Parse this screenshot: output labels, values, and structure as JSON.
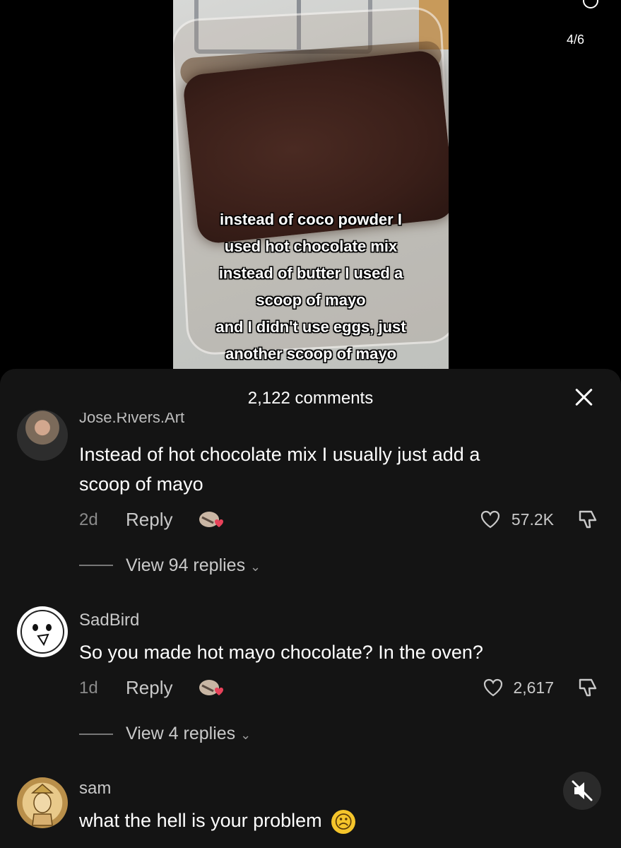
{
  "video": {
    "page_counter": "4/6",
    "caption_lines": [
      "instead of coco powder I",
      "used hot chocolate mix",
      "instead of butter I used a",
      "scoop of mayo",
      "and I didn't use eggs, just",
      "another scoop of mayo"
    ]
  },
  "sheet": {
    "title": "2,122 comments"
  },
  "comments": [
    {
      "username": "Jose.Rivers.Art",
      "text_line1": "Instead of hot chocolate mix I usually just add a",
      "text_line2": "scoop of mayo",
      "age": "2d",
      "reply_label": "Reply",
      "likes": "57.2K",
      "view_replies": "View 94 replies"
    },
    {
      "username": "SadBird",
      "text": "So you made hot mayo chocolate? In the oven?",
      "age": "1d",
      "reply_label": "Reply",
      "likes": "2,617",
      "view_replies": "View 4 replies"
    },
    {
      "username": "sam",
      "text": "what the hell is your problem",
      "emoji": "☹"
    }
  ],
  "icons": {
    "close": "close-icon",
    "heart": "heart-icon",
    "dislike": "thumbs-down-icon",
    "mute": "mute-icon",
    "chevron": "chevron-down-icon"
  }
}
